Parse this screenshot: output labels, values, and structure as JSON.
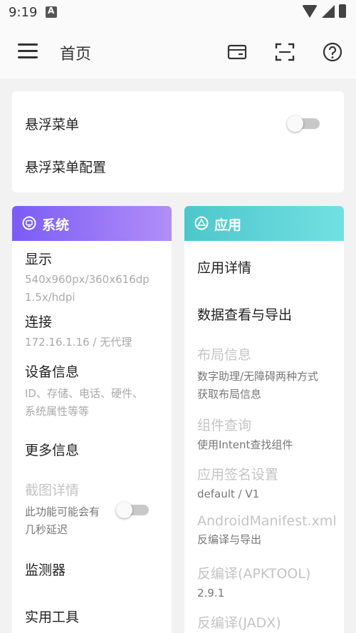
{
  "status_bar": {
    "time": "9:19"
  },
  "app_bar": {
    "title": "首页"
  },
  "top_card": {
    "float_menu_label": "悬浮菜单",
    "float_menu_config_label": "悬浮菜单配置",
    "float_menu_enabled": false
  },
  "system": {
    "header": "系统",
    "display_title": "显示",
    "display_sub1": "540x960px/360x616dp",
    "display_sub2": "1.5x/hdpi",
    "connect_title": "连接",
    "connect_sub": "172.16.1.16 / 无代理",
    "device_title": "设备信息",
    "device_sub1": "ID、存储、电话、硬件、",
    "device_sub2": "系统属性等等",
    "more_title": "更多信息",
    "screenshot_title": "截图详情",
    "screenshot_sub1": "此功能可能会有",
    "screenshot_sub2": "几秒延迟",
    "screenshot_enabled": false,
    "monitor_title": "监测器",
    "tools_title": "实用工具"
  },
  "apps": {
    "header": "应用",
    "app_detail_title": "应用详情",
    "data_export_title": "数据查看与导出",
    "layout_title": "布局信息",
    "layout_sub1": "数字助理/无障碍两种方式",
    "layout_sub2": "获取布局信息",
    "component_title": "组件查询",
    "component_sub": "使用Intent查找组件",
    "sign_title": "应用签名设置",
    "sign_sub": "default / V1",
    "manifest_title": "AndroidManifest.xml",
    "manifest_sub": "反编译与导出",
    "apktool_title": "反编译(APKTOOL)",
    "apktool_sub": "2.9.1",
    "jadx_title": "反编译(JADX)"
  },
  "colors": {
    "system_gradient_start": "#7b5cf5",
    "system_gradient_end": "#b18ef8",
    "apps_gradient_start": "#4dc7cb",
    "apps_gradient_end": "#72e0e3"
  },
  "icons": [
    "menu-icon",
    "card-icon",
    "scan-icon",
    "help-icon",
    "system-icon",
    "apps-icon"
  ]
}
